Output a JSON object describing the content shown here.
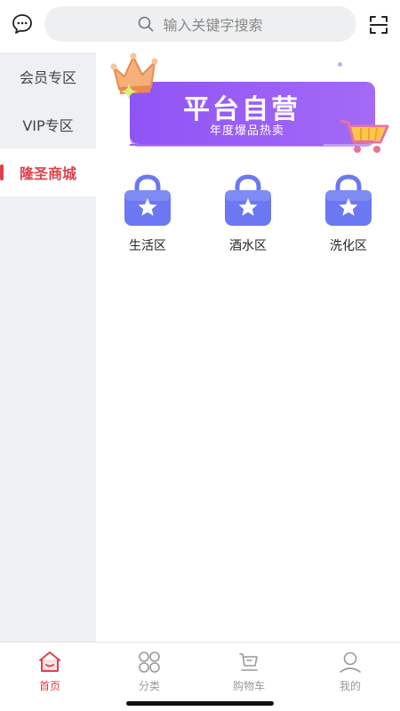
{
  "header": {
    "search_placeholder": "输入关键字搜索",
    "chat_icon": "chat-bubble-icon",
    "scan_icon": "scan-icon"
  },
  "sidebar": {
    "items": [
      {
        "label": "会员专区",
        "active": false
      },
      {
        "label": "VIP专区",
        "active": false
      },
      {
        "label": "隆圣商城",
        "active": true
      }
    ]
  },
  "banner": {
    "title": "平台自营",
    "subtitle": "年度爆品热卖"
  },
  "categories": [
    {
      "label": "生活区",
      "icon": "star-bag-icon"
    },
    {
      "label": "酒水区",
      "icon": "star-bag-icon"
    },
    {
      "label": "洗化区",
      "icon": "star-bag-icon"
    }
  ],
  "tabbar": {
    "items": [
      {
        "label": "首页",
        "icon": "home-icon",
        "active": true
      },
      {
        "label": "分类",
        "icon": "category-icon",
        "active": false
      },
      {
        "label": "购物车",
        "icon": "cart-icon",
        "active": false
      },
      {
        "label": "我的",
        "icon": "profile-icon",
        "active": false
      }
    ]
  },
  "colors": {
    "accent": "#e0414a",
    "banner_purple": "#8f54f5",
    "sidebar_bg": "#eff0f2",
    "icon_blue": "#6b78f2"
  }
}
